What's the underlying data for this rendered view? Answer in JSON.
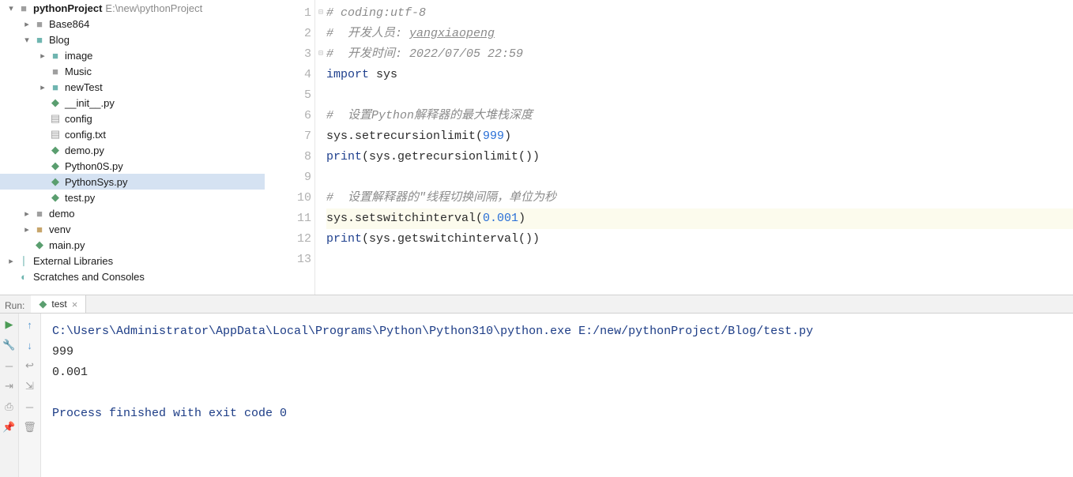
{
  "tree": {
    "root": {
      "name": "pythonProject",
      "path": "E:\\new\\pythonProject"
    },
    "items": [
      {
        "label": "Base864",
        "indent": 1,
        "chev": "right",
        "icon": "folder-gray"
      },
      {
        "label": "Blog",
        "indent": 1,
        "chev": "down",
        "icon": "folder-teal"
      },
      {
        "label": "image",
        "indent": 2,
        "chev": "right",
        "icon": "folder-teal"
      },
      {
        "label": "Music",
        "indent": 2,
        "chev": "",
        "icon": "folder-gray"
      },
      {
        "label": "newTest",
        "indent": 2,
        "chev": "right",
        "icon": "folder-teal"
      },
      {
        "label": "__init__.py",
        "indent": 2,
        "chev": "",
        "icon": "py"
      },
      {
        "label": "config",
        "indent": 2,
        "chev": "",
        "icon": "file"
      },
      {
        "label": "config.txt",
        "indent": 2,
        "chev": "",
        "icon": "file"
      },
      {
        "label": "demo.py",
        "indent": 2,
        "chev": "",
        "icon": "py"
      },
      {
        "label": "Python0S.py",
        "indent": 2,
        "chev": "",
        "icon": "py"
      },
      {
        "label": "PythonSys.py",
        "indent": 2,
        "chev": "",
        "icon": "py",
        "selected": true
      },
      {
        "label": "test.py",
        "indent": 2,
        "chev": "",
        "icon": "py"
      },
      {
        "label": "demo",
        "indent": 1,
        "chev": "right",
        "icon": "folder-gray"
      },
      {
        "label": "venv",
        "indent": 1,
        "chev": "right",
        "icon": "folder-tan"
      },
      {
        "label": "main.py",
        "indent": 1,
        "chev": "",
        "icon": "py"
      },
      {
        "label": "External Libraries",
        "indent": 0,
        "chev": "right",
        "icon": "lib"
      },
      {
        "label": "Scratches and Consoles",
        "indent": 0,
        "chev": "",
        "icon": "scratch"
      }
    ]
  },
  "code": {
    "lines": [
      {
        "n": "1",
        "marker": true,
        "tokens": [
          {
            "cls": "cm-comment",
            "t": "# coding:utf-8"
          }
        ]
      },
      {
        "n": "2",
        "tokens": [
          {
            "cls": "cm-comment",
            "t": "#  开发人员: "
          },
          {
            "cls": "cm-comment cm-under",
            "t": "yangxiaopeng"
          }
        ]
      },
      {
        "n": "3",
        "marker": true,
        "tokens": [
          {
            "cls": "cm-comment",
            "t": "#  开发时间: 2022/07/05 22:59"
          }
        ]
      },
      {
        "n": "4",
        "tokens": [
          {
            "cls": "cm-keyword",
            "t": "import "
          },
          {
            "cls": "cm-ident",
            "t": "sys"
          }
        ]
      },
      {
        "n": "5",
        "tokens": []
      },
      {
        "n": "6",
        "tokens": [
          {
            "cls": "cm-comment",
            "t": "#  设置Python解释器的最大堆栈深度"
          }
        ]
      },
      {
        "n": "7",
        "tokens": [
          {
            "cls": "cm-ident",
            "t": "sys.setrecursionlimit("
          },
          {
            "cls": "cm-num",
            "t": "999"
          },
          {
            "cls": "cm-ident",
            "t": ")"
          }
        ]
      },
      {
        "n": "8",
        "tokens": [
          {
            "cls": "cm-keyword",
            "t": "print"
          },
          {
            "cls": "cm-ident",
            "t": "(sys.getrecursionlimit())"
          }
        ]
      },
      {
        "n": "9",
        "tokens": []
      },
      {
        "n": "10",
        "tokens": [
          {
            "cls": "cm-comment",
            "t": "#  设置解释器的\"线程切换间隔，单位为秒"
          }
        ]
      },
      {
        "n": "11",
        "hl": true,
        "tokens": [
          {
            "cls": "cm-ident",
            "t": "sys.setswitchinterval("
          },
          {
            "cls": "cm-num",
            "t": "0.001"
          },
          {
            "cls": "cm-ident",
            "t": ")"
          }
        ]
      },
      {
        "n": "12",
        "tokens": [
          {
            "cls": "cm-keyword",
            "t": "print"
          },
          {
            "cls": "cm-ident",
            "t": "(sys.getswitchinterval())"
          }
        ]
      },
      {
        "n": "13",
        "tokens": []
      }
    ]
  },
  "run": {
    "label": "Run:",
    "tab": "test",
    "command": "C:\\Users\\Administrator\\AppData\\Local\\Programs\\Python\\Python310\\python.exe E:/new/pythonProject/Blog/test.py",
    "out1": "999",
    "out2": "0.001",
    "exit": "Process finished with exit code 0"
  }
}
